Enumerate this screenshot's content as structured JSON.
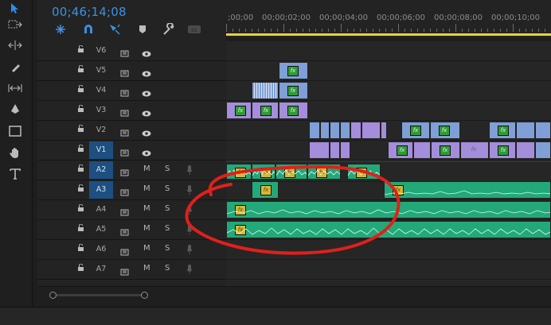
{
  "timecode": "00;46;14;08",
  "ruler": {
    "labels": [
      ";00;00",
      "00;00;02;00",
      "00;00;04;00",
      "00;00;06;00",
      "00;00;08;00",
      "00;00;10;00"
    ]
  },
  "tracks": {
    "video": [
      {
        "name": "V6",
        "active": false
      },
      {
        "name": "V5",
        "active": false
      },
      {
        "name": "V4",
        "active": false
      },
      {
        "name": "V3",
        "active": false
      },
      {
        "name": "V2",
        "active": false
      },
      {
        "name": "V1",
        "active": true
      }
    ],
    "audio": [
      {
        "name": "A2",
        "active": true
      },
      {
        "name": "A3",
        "active": true
      },
      {
        "name": "A4",
        "active": false
      },
      {
        "name": "A5",
        "active": false
      },
      {
        "name": "A6",
        "active": false
      },
      {
        "name": "A7",
        "active": false
      }
    ],
    "mute_label": "M",
    "solo_label": "S"
  },
  "fx_label": "fx",
  "icons": {
    "tools": [
      "selection-tool-icon",
      "track-select-forward-icon",
      "ripple-edit-icon",
      "razor-icon",
      "slip-icon",
      "pen-icon",
      "rectangle-icon",
      "hand-icon",
      "type-icon"
    ],
    "header": [
      "nest-icon",
      "snap-icon",
      "linked-selection-icon",
      "add-marker-icon",
      "timeline-settings-icon",
      "captions-icon"
    ]
  },
  "colors": {
    "playhead": "#e8d23a",
    "video_blue": "#7f9fd6",
    "video_purple": "#a48ddb",
    "audio": "#23a979",
    "active_track": "#1d4f80",
    "annotation": "#e0201b",
    "timecode": "#3f8fe0"
  }
}
